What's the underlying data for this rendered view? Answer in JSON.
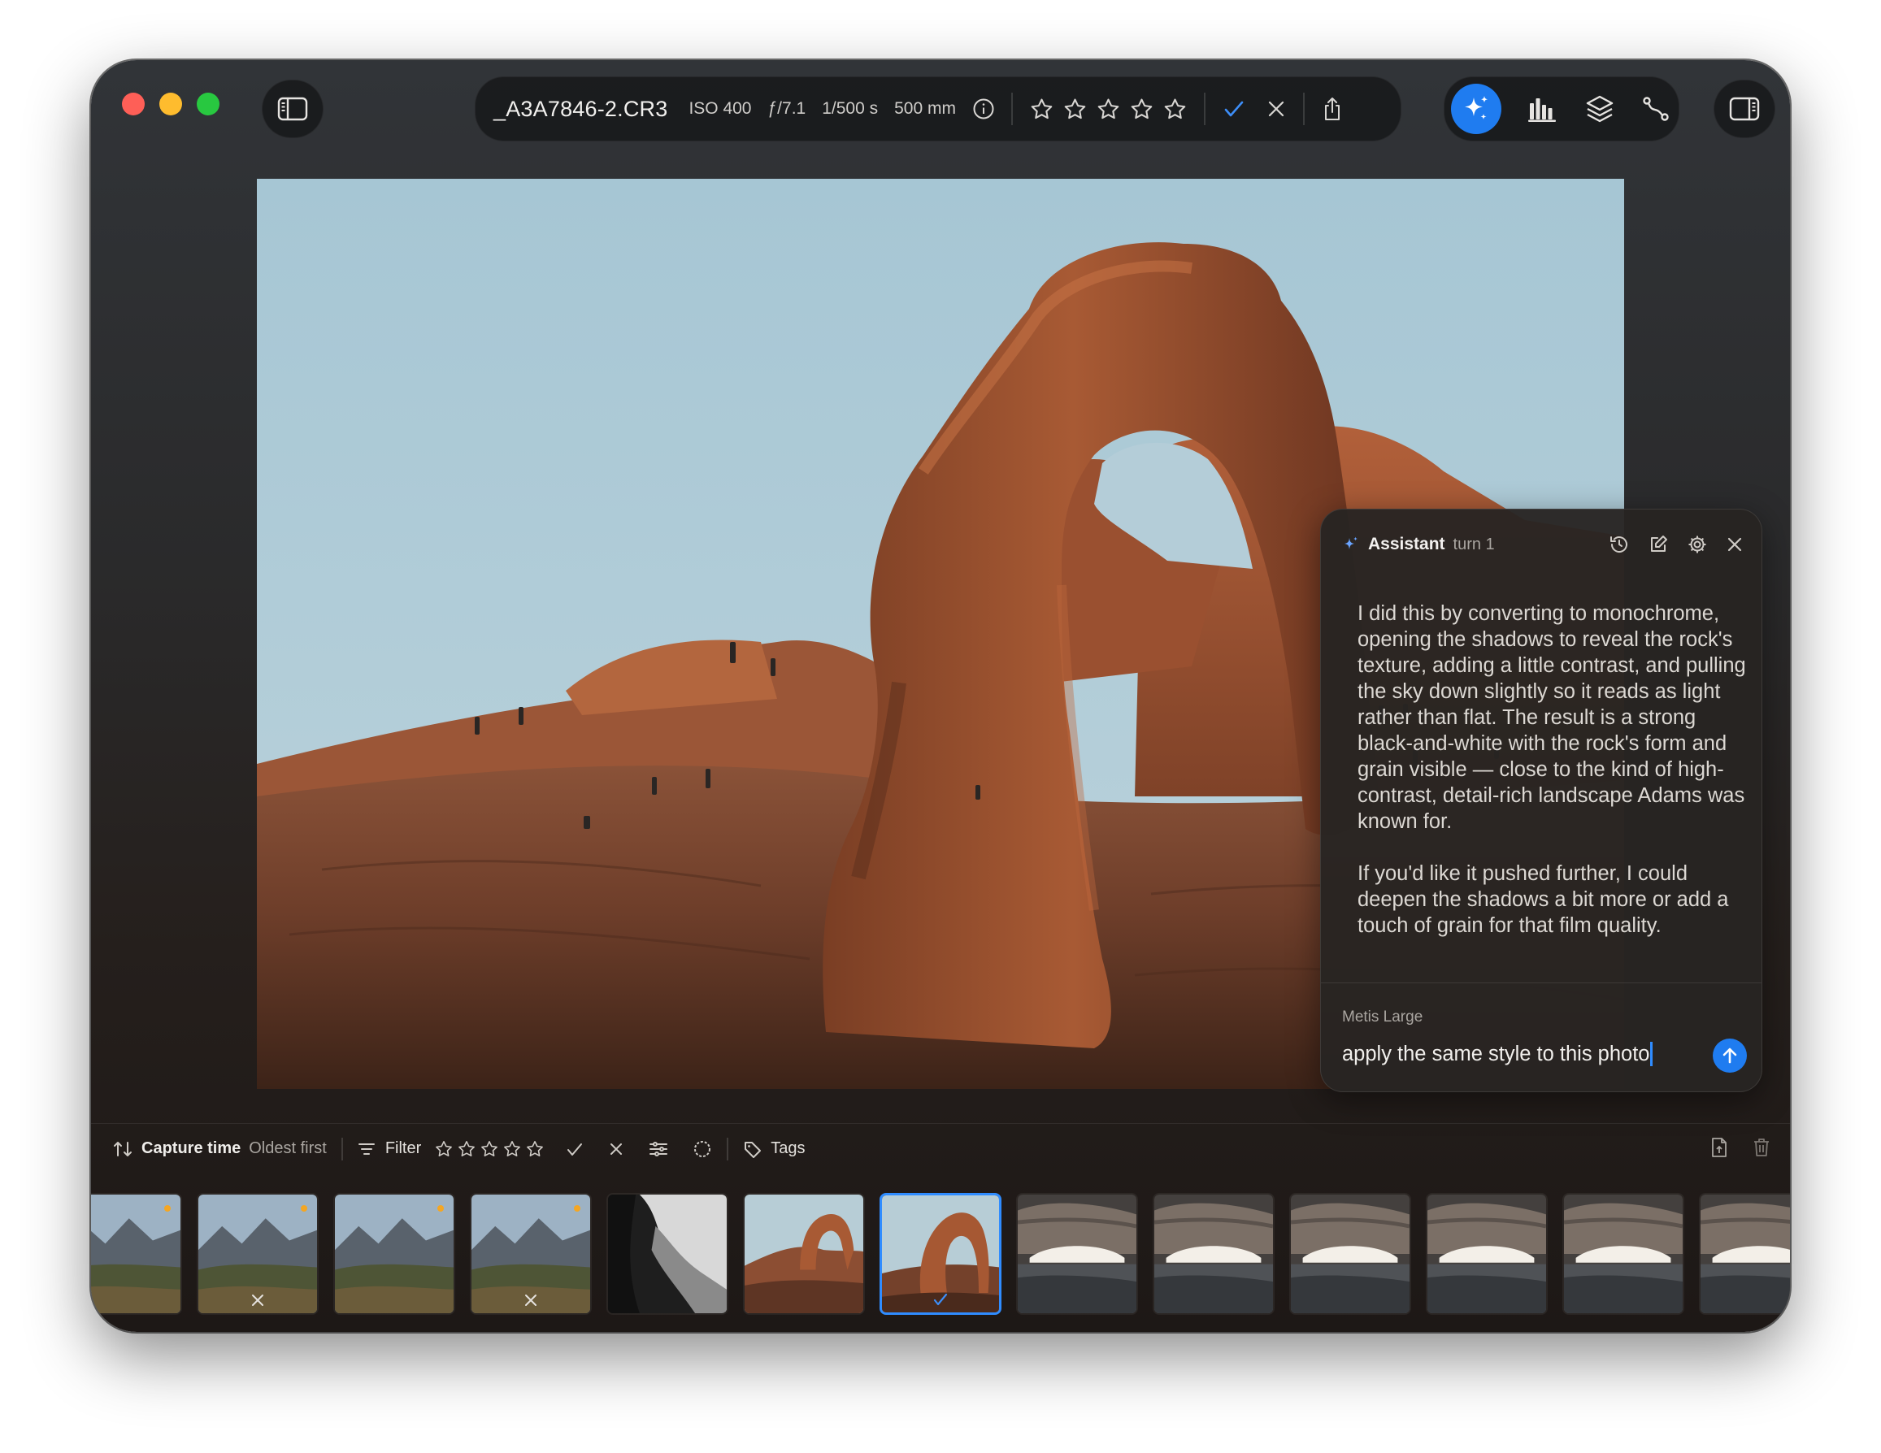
{
  "window": {
    "traffic_lights": [
      "close",
      "minimize",
      "zoom"
    ],
    "colors": {
      "red": "#fe5f57",
      "yellow": "#febc2e",
      "green": "#28c840",
      "accent": "#1f7cf0"
    }
  },
  "toolbar": {
    "filename": "_A3A7846-2.CR3",
    "iso": "ISO 400",
    "aperture": "ƒ/7.1",
    "shutter": "1/500 s",
    "focal_length": "500 mm",
    "rating_stars": 0,
    "tools": [
      "sparkle-icon",
      "histogram-icon",
      "layers-icon",
      "curve-icon"
    ],
    "active_tool": "sparkle-icon"
  },
  "assistant": {
    "title": "Assistant",
    "turn": "turn 1",
    "message": [
      "I did this by converting to monochrome, opening the shadows to reveal the rock's texture, adding a little contrast, and pulling the sky down slightly so it reads as light rather than flat. The result is a strong black-and-white with the rock's form and grain visible — close to the kind of high-contrast, detail-rich landscape Adams was known for.",
      "If you'd like it pushed further, I could deepen the shadows a bit more or add a touch of grain for that film quality."
    ],
    "model": "Metis Large",
    "input_value": "apply the same style to this photo"
  },
  "filterbar": {
    "sort_label": "Capture time",
    "sort_order": "Oldest first",
    "filter_label": "Filter",
    "tags_label": "Tags"
  },
  "filmstrip": {
    "thumbnails": [
      {
        "scene": "mountain-valley",
        "flag": "dot"
      },
      {
        "scene": "mountain-valley",
        "flag": "dot",
        "mark": "reject"
      },
      {
        "scene": "mountain-valley",
        "flag": "dot"
      },
      {
        "scene": "mountain-valley",
        "flag": "dot",
        "mark": "reject"
      },
      {
        "scene": "bw-rock"
      },
      {
        "scene": "arch-wide"
      },
      {
        "scene": "arch",
        "selected": true,
        "mark": "pick"
      },
      {
        "scene": "mesa-arch"
      },
      {
        "scene": "mesa-arch"
      },
      {
        "scene": "mesa-arch"
      },
      {
        "scene": "mesa-arch"
      },
      {
        "scene": "mesa-arch"
      },
      {
        "scene": "mesa-arch"
      }
    ]
  }
}
